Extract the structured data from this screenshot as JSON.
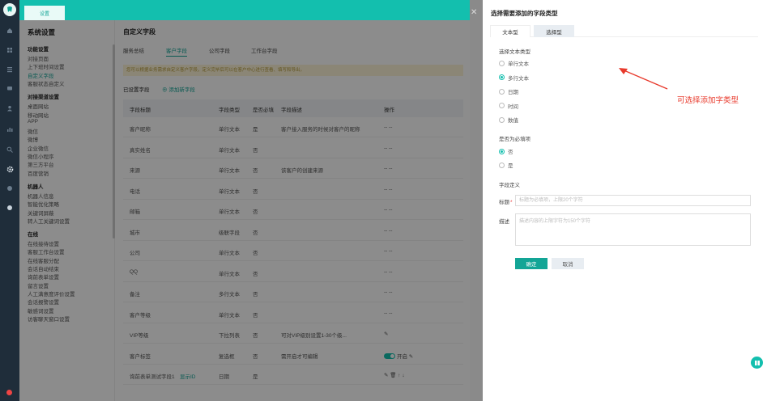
{
  "topbar": {
    "tab_label": "设置"
  },
  "menu": {
    "title": "系统设置",
    "groups": [
      {
        "title": "功能设置",
        "items": [
          "对接页面",
          "上下班时间设置",
          "自定义字段",
          "客服状态自定义"
        ]
      },
      {
        "title": "对接渠道设置",
        "items": [
          "桌面网站",
          "移动网站",
          "APP",
          "微信",
          "微博",
          "企业微信",
          "微信小程序",
          "第三方平台",
          "百度营销"
        ]
      },
      {
        "title": "机器人",
        "items": [
          "机器人信息",
          "智能优化策略",
          "关键词屏蔽",
          "转人工关键词设置"
        ]
      },
      {
        "title": "在线",
        "items": [
          "在线接待设置",
          "客服工作台设置",
          "在线客服分配",
          "会话自动结束",
          "询前表单设置",
          "留言设置",
          "人工满意度评价设置",
          "会话报警设置",
          "敏感词设置",
          "访客聊天窗口设置"
        ]
      }
    ]
  },
  "main": {
    "title": "自定义字段",
    "tabs": [
      "服务总结",
      "客户字段",
      "公司字段",
      "工作台字段"
    ],
    "active_tab": 1,
    "notice": "您可以根据业务需求自定义客户字段，定义完毕后可以在客户中心进行查看、填写和导出。",
    "set_label": "已设置字段",
    "add_field": "添加新字段",
    "headers": [
      "字段标题",
      "字段类型",
      "是否必填",
      "字段描述",
      "操作"
    ],
    "rows": [
      {
        "title": "客户昵称",
        "type": "单行文本",
        "req": "是",
        "desc": "客户接入服务的时候对客户的昵称",
        "ops": "-- --"
      },
      {
        "title": "真实姓名",
        "type": "单行文本",
        "req": "否",
        "desc": "",
        "ops": "-- --"
      },
      {
        "title": "来源",
        "type": "单行文本",
        "req": "否",
        "desc": "该客户的创建来源",
        "ops": "-- --"
      },
      {
        "title": "电话",
        "type": "单行文本",
        "req": "否",
        "desc": "",
        "ops": "-- --"
      },
      {
        "title": "邮箱",
        "type": "单行文本",
        "req": "否",
        "desc": "",
        "ops": "-- --"
      },
      {
        "title": "城市",
        "type": "级联字段",
        "req": "否",
        "desc": "",
        "ops": "-- --"
      },
      {
        "title": "公司",
        "type": "单行文本",
        "req": "否",
        "desc": "",
        "ops": "-- --"
      },
      {
        "title": "QQ",
        "type": "单行文本",
        "req": "否",
        "desc": "",
        "ops": "-- --"
      },
      {
        "title": "备注",
        "type": "多行文本",
        "req": "否",
        "desc": "",
        "ops": "-- --"
      },
      {
        "title": "客户等级",
        "type": "单行文本",
        "req": "否",
        "desc": "",
        "ops": "-- --"
      },
      {
        "title": "VIP等级",
        "type": "下拉列表",
        "req": "否",
        "desc": "可对VIP级别设置1-30个级...",
        "ops": "✎"
      },
      {
        "title": "客户标签",
        "type": "复选框",
        "req": "否",
        "desc": "需开启才可编辑",
        "ops": "开启 ✎"
      },
      {
        "title": "询前表单测试字段1",
        "type": "日期",
        "req": "是",
        "desc": "",
        "ops": "✎ 🗑 ↑ ↓",
        "extra": "显示ID"
      }
    ]
  },
  "drawer": {
    "title": "选择需要添加的字段类型",
    "tabs": [
      "文本型",
      "选择型"
    ],
    "text_type_label": "选择文本类型",
    "text_types": [
      "单行文本",
      "多行文本",
      "日期",
      "时间",
      "数值"
    ],
    "selected_text_type": 1,
    "required_label": "是否为必填项",
    "required_options": [
      "否",
      "是"
    ],
    "required_selected": 0,
    "define_label": "字段定义",
    "title_label": "标题",
    "title_placeholder": "标题为必填项，上限20个字符",
    "desc_label": "描述",
    "desc_placeholder": "描述内容的上限字符为150个字符",
    "ok": "确定",
    "cancel": "取消"
  },
  "annotation": "可选择添加字类型",
  "colors": {
    "accent": "#13bfae",
    "annotation": "#e83a2c"
  }
}
